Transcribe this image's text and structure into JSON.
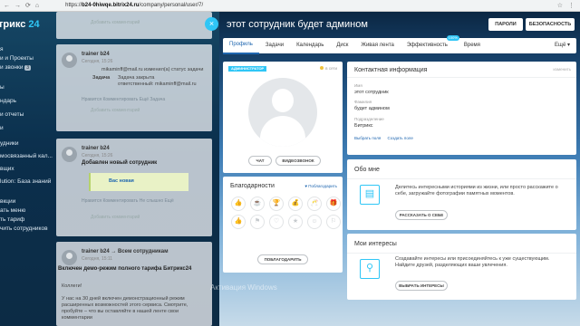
{
  "browser": {
    "url_prefix": "https://",
    "url_domain": "b24-0hiwqe.bitrix24.ru",
    "url_path": "/company/personal/user/7/"
  },
  "sidebar": {
    "logo_a": "трикс",
    "logo_b": "24",
    "items": [
      {
        "label": "я"
      },
      {
        "label": "и и Проекты"
      },
      {
        "label": "и звонки",
        "badge": "3"
      },
      {
        "label": "ы"
      },
      {
        "label": "ндарь"
      },
      {
        "label": "и отчеты"
      },
      {
        "label": "и"
      },
      {
        "label": "удники"
      },
      {
        "label": "мосвязанный кал..."
      },
      {
        "label": "вщих"
      },
      {
        "label": "lution: База знаний"
      },
      {
        "label": "вкции"
      },
      {
        "label": "ать меню"
      },
      {
        "label": "ть тариф"
      },
      {
        "label": "чить сотрудников"
      }
    ]
  },
  "feed": {
    "post1": {
      "add_comment": "Добавить комментарий"
    },
    "post2": {
      "author": "trainer b24",
      "time": "Сегодня, 15:26",
      "line1": "mikaminff@mail.ru изменил(а) статус задачи",
      "task": "Задача",
      "task_status": "Задача закрыта",
      "responsible": "ответственный: mikaminff@mail.ru",
      "links": "Нравится   Комментировать   Ещё   Задача",
      "add_comment": "Добавить комментарий"
    },
    "post3": {
      "author": "trainer b24",
      "time": "Сегодня, 15:26",
      "title": "Добавлен новый сотрудник",
      "mention": "Вас новая",
      "links": "Нравится   Комментировать   Не слышно   Ещё",
      "add_comment": "Добавить комментарий"
    },
    "post4": {
      "author": "trainer b24 → Всем сотрудникам",
      "time": "Сегодня, 15:11",
      "title": "Включен демо-режим полного тарифа Битрикс24",
      "subtitle": "Коллеги!",
      "text": "У нас на 30 дней включен демонстрационный режим расширенных возможностей этого сервиса. Смотрите, пробуйте – что вы оставляйте в нашей ленте свои комментарии"
    }
  },
  "panel": {
    "title": "этот сотрудник будет админом",
    "passwords_btn": "ПАРОЛИ",
    "security_btn": "БЕЗОПАСНОСТЬ",
    "tabs": [
      {
        "label": "Профиль",
        "active": true
      },
      {
        "label": "Задачи"
      },
      {
        "label": "Календарь"
      },
      {
        "label": "Диск"
      },
      {
        "label": "Живая лента"
      },
      {
        "label": "Эффективность",
        "pct": "100%"
      },
      {
        "label": "Время"
      },
      {
        "label": "Ещё ▾"
      }
    ],
    "profile_card": {
      "admin_label": "АДМИНИСТРАТОР",
      "online": "в сети",
      "chat_btn": "ЧАТ",
      "video_btn": "ВИДЕОЗВОНОК"
    },
    "gratitude": {
      "title": "Благодарности",
      "thank_link": "♥ Поблагодарить",
      "thank_btn": "ПОБЛАГОДАРИТЬ",
      "icons": [
        "👍",
        "☕",
        "🏆",
        "💰",
        "🥂",
        "🎁",
        "👍",
        "⚑",
        "♡",
        "★",
        "☺",
        "⚐"
      ]
    },
    "contact": {
      "title": "Контактная информация",
      "edit": "изменить",
      "name_label": "Имя",
      "name_value": "этот сотрудник",
      "surname_label": "Фамилия",
      "surname_value": "будет админом",
      "dept_label": "Подразделение",
      "dept_value": "Битрикс",
      "choose_link": "Выбрать поля",
      "create_link": "Создать поле"
    },
    "about": {
      "title": "Обо мне",
      "text": "Делитесь интересными историями из жизни, или просто расскажите о себе, загружайте фотографии памятных моментов.",
      "button": "РАССКАЗАТЬ О СЕБЕ"
    },
    "interests": {
      "title": "Мои интересы",
      "text": "Создавайте интересы или присоединяйтесь к уже существующим. Найдите друзей, разделяющих ваши увлечения.",
      "button": "ВЫБРАТЬ ИНТЕРЕСЫ"
    },
    "watermark": "Активация Windows"
  }
}
